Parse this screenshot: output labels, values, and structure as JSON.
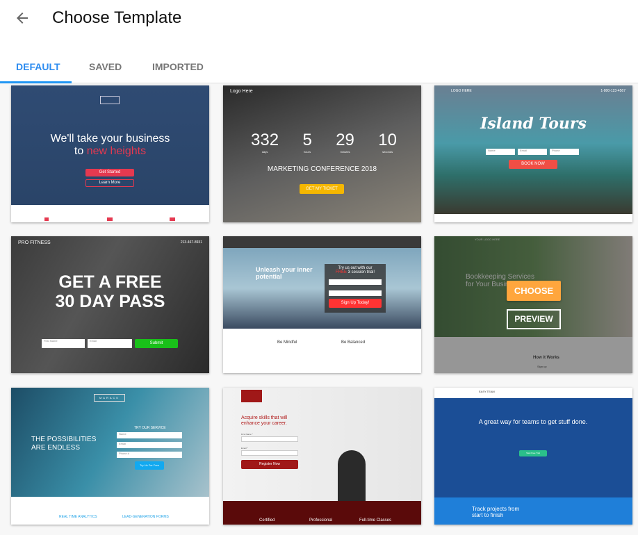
{
  "header": {
    "title": "Choose Template",
    "back_icon": "arrow-left-icon"
  },
  "tabs": [
    {
      "label": "DEFAULT",
      "active": true
    },
    {
      "label": "SAVED",
      "active": false
    },
    {
      "label": "IMPORTED",
      "active": false
    }
  ],
  "colors": {
    "accent": "#2196f3",
    "choose": "#ffa63d"
  },
  "hover": {
    "choose_label": "CHOOSE",
    "preview_label": "PREVIEW"
  },
  "templates": [
    {
      "headline1": "We'll take your business",
      "headline2_pre": "to ",
      "headline2_accent": "new heights",
      "btn1": "Get Started",
      "btn2": "Learn More"
    },
    {
      "logo": "Logo Here",
      "counts": [
        "332",
        "5",
        "29",
        "10"
      ],
      "units": [
        "days",
        "hours",
        "minutes",
        "seconds"
      ],
      "headline": "MARKETING CONFERENCE 2018",
      "btn": "GET MY TICKET"
    },
    {
      "logo": "LOGO HERE",
      "phone": "1-800-123-4567",
      "headline": "Island Tours",
      "fields": [
        "Name",
        "Email",
        "Phone"
      ],
      "btn": "BOOK NOW"
    },
    {
      "logo": "PRO FITNESS",
      "phone": "213-467-8931",
      "headline1": "GET A FREE",
      "headline2": "30 DAY PASS",
      "fields": [
        "First Name",
        "Email"
      ],
      "btn": "Submit"
    },
    {
      "headline": "Unleash your inner potential",
      "form_title1": "Try us out with our",
      "form_accent": "FREE",
      "form_title2": "3 session trial!",
      "btn": "Sign Up Today!",
      "feature1": "Be Mindful",
      "feature2": "Be Balanced"
    },
    {
      "logo": "YOUR LOGO HERE",
      "headline": "Bookkeeping Services for Your Business",
      "section": "How it Works",
      "step": "Sign up"
    },
    {
      "logo": "MARACK",
      "form_title": "TRY OUR SERVICE",
      "headline1": "THE POSSIBILITIES",
      "headline2": "ARE ENDLESS",
      "fields": [
        "Name",
        "Email",
        "Phone #"
      ],
      "btn": "Try Us For Free",
      "feature1": "REAL TIME ANALYTICS",
      "feature2": "LEAD-GENERATION FORMS"
    },
    {
      "headline1": "Acquire skills that will",
      "headline2": "enhance your career.",
      "fields": [
        "First Name *",
        "Email *"
      ],
      "btn": "Register Now",
      "features": [
        "Certified",
        "Professional",
        "Full-time Classes"
      ]
    },
    {
      "logo": "EASY TEAM",
      "headline": "A great way for teams to get stuff done.",
      "btn": "Start Free Trial",
      "footer": "Track projects from start to finish"
    }
  ]
}
